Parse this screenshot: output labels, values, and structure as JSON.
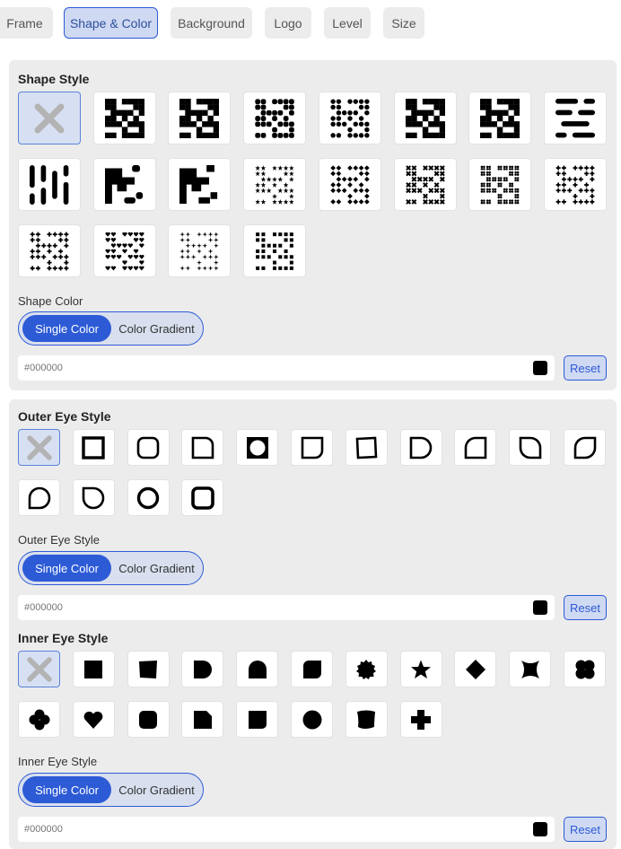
{
  "tabs": [
    "Frame",
    "Shape & Color",
    "Background",
    "Logo",
    "Level",
    "Size"
  ],
  "active_tab": "Shape & Color",
  "shape_section": {
    "title": "Shape Style",
    "color_label": "Shape Color",
    "toggle": {
      "single": "Single Color",
      "gradient": "Color Gradient"
    },
    "color_placeholder": "#000000",
    "reset": "Reset",
    "styles": [
      "none-icon",
      "square-dots-icon",
      "square-dots-icon",
      "rounded-dots-icon",
      "circle-dots-icon",
      "square-dots-icon",
      "square-dots-icon",
      "horizontal-bars-icon",
      "vertical-bars-icon",
      "connected-rounded-icon",
      "connected-square-icon",
      "star-dots-icon",
      "diamond-dots-icon",
      "x-dots-icon",
      "cross-circle-dots-icon",
      "plus-dots-icon",
      "cross-dots-icon",
      "heart-dots-icon",
      "sparkle-dots-icon",
      "small-square-dots-icon"
    ]
  },
  "outer_eye_section": {
    "title": "Outer Eye Style",
    "color_label": "Outer Eye Style",
    "toggle": {
      "single": "Single Color",
      "gradient": "Color Gradient"
    },
    "color_placeholder": "#000000",
    "reset": "Reset",
    "styles": [
      "none-icon",
      "square-frame-icon",
      "rounded-frame-icon",
      "leaf-right-frame-icon",
      "circle-in-square-frame-icon",
      "corner-rounded-frame-icon",
      "skewed-frame-icon",
      "leaf-frame-icon",
      "leaf-frame-icon",
      "leaf-frame-icon",
      "leaf-frame-icon",
      "drop-frame-icon",
      "drop-frame-icon",
      "circle-frame-icon",
      "thick-rounded-frame-icon"
    ]
  },
  "inner_eye_section": {
    "title": "Inner Eye Style",
    "color_label": "Inner Eye Style",
    "toggle": {
      "single": "Single Color",
      "gradient": "Color Gradient"
    },
    "color_placeholder": "#000000",
    "reset": "Reset",
    "styles": [
      "none-icon",
      "square-icon",
      "skewed-square-icon",
      "half-round-icon",
      "quarter-circle-icon",
      "leaf-icon",
      "badge-icon",
      "star-icon",
      "diamond-icon",
      "pinched-square-icon",
      "four-lobe-icon",
      "clover-icon",
      "heart-icon",
      "rounded-square-icon",
      "corner-cut-square-icon",
      "rounded-corner-square-icon",
      "circle-icon",
      "wavy-square-icon",
      "plus-icon"
    ]
  }
}
